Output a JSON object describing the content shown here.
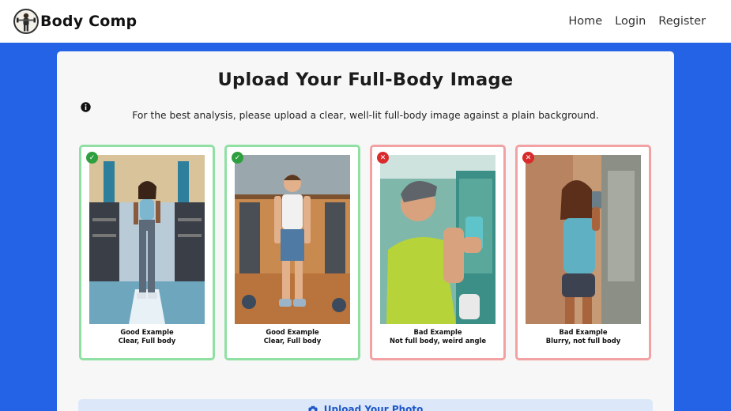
{
  "brand": {
    "name": "Body Comp"
  },
  "nav": {
    "links": [
      "Home",
      "Login",
      "Register"
    ]
  },
  "page": {
    "title": "Upload Your Full-Body Image",
    "intro": "For the best analysis, please upload a clear, well-lit full-body image against a plain background."
  },
  "examples": [
    {
      "status": "good",
      "title": "Good Example",
      "caption": "Clear, Full body"
    },
    {
      "status": "good",
      "title": "Good Example",
      "caption": "Clear, Full body"
    },
    {
      "status": "bad",
      "title": "Bad Example",
      "caption": "Not full body, weird angle"
    },
    {
      "status": "bad",
      "title": "Bad Example",
      "caption": "Blurry, not full body"
    }
  ],
  "upload": {
    "label": "Upload Your Photo"
  },
  "colors": {
    "background": "#2563e6",
    "good": "#2e9f3e",
    "bad": "#d92b2b",
    "good_border": "#90e0a4",
    "bad_border": "#f2a2a2"
  },
  "icons": {
    "info": "info-circle-icon",
    "good": "check-icon",
    "bad": "x-icon",
    "upload": "camera-icon"
  }
}
